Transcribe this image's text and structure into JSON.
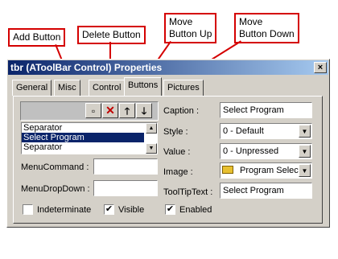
{
  "callouts": {
    "add": "Add Button",
    "delete": "Delete Button",
    "move_up_line1": "Move",
    "move_up_line2": "Button Up",
    "move_down_line1": "Move",
    "move_down_line2": "Button Down"
  },
  "window": {
    "title": "tbr (AToolBar Control) Properties",
    "close_glyph": "×"
  },
  "tabs": [
    "General",
    "Misc",
    "Control",
    "Buttons",
    "Pictures"
  ],
  "active_tab": "Buttons",
  "toolbar_buttons": {
    "add_glyph": "▫",
    "delete_glyph": "✕",
    "up_glyph": "🡑",
    "down_glyph": "🡓"
  },
  "button_list": {
    "items": [
      "Separator",
      "Select Program",
      "Separator"
    ],
    "selected": "Select Program"
  },
  "fields": {
    "menu_command_label": "MenuCommand :",
    "menu_command_value": "",
    "menu_dropdown_label": "MenuDropDown :",
    "menu_dropdown_value": "",
    "caption_label": "Caption :",
    "caption_value": "Select Program",
    "style_label": "Style :",
    "style_value": "0 - Default",
    "value_label": "Value :",
    "value_value": "0 - Unpressed",
    "image_label": "Image :",
    "image_value": "Program Select",
    "tooltip_label": "ToolTipText :",
    "tooltip_value": "Select Program"
  },
  "checkboxes": {
    "indeterminate_label": "Indeterminate",
    "indeterminate_checked": false,
    "visible_label": "Visible",
    "visible_checked": true,
    "enabled_label": "Enabled",
    "enabled_checked": true,
    "check_glyph": "✔"
  },
  "colors": {
    "callout_red": "#d40000",
    "title_bar": "#0a246a",
    "selection": "#0a246a",
    "dialog_face": "#d4d0c8"
  }
}
